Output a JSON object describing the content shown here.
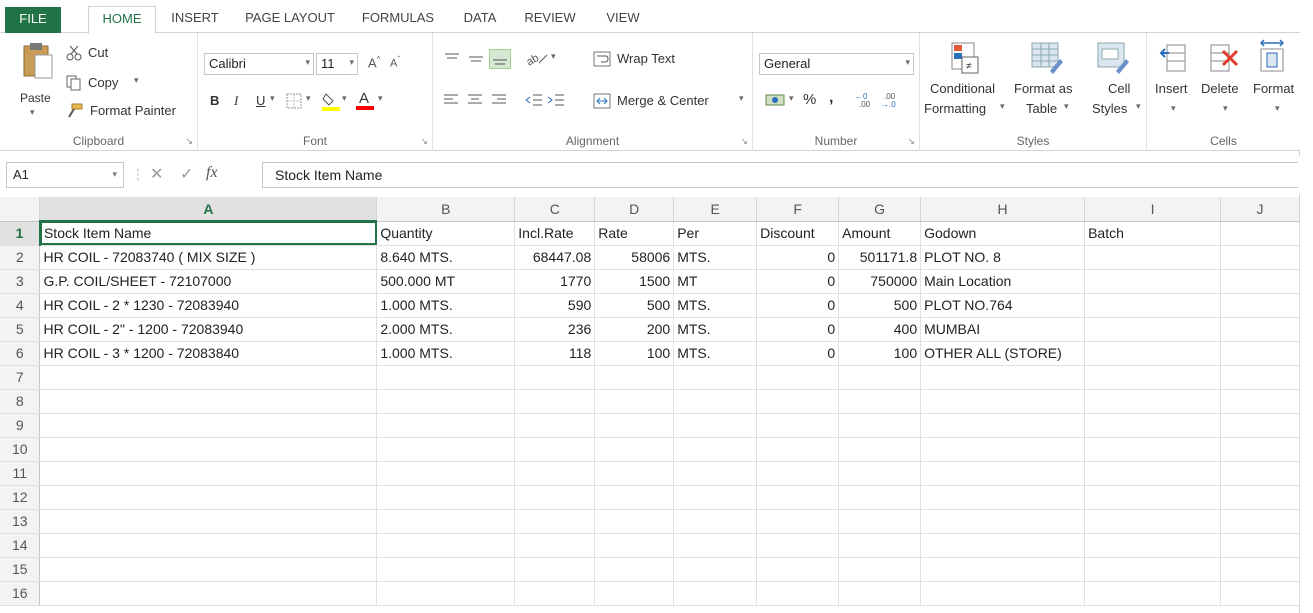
{
  "tabs": [
    "FILE",
    "HOME",
    "INSERT",
    "PAGE LAYOUT",
    "FORMULAS",
    "DATA",
    "REVIEW",
    "VIEW"
  ],
  "clipboard": {
    "paste": "Paste",
    "cut": "Cut",
    "copy": "Copy",
    "format_painter": "Format Painter",
    "label": "Clipboard"
  },
  "font": {
    "name": "Calibri",
    "size": "11",
    "label": "Font",
    "bold": "B",
    "italic": "I",
    "underline": "U"
  },
  "alignment": {
    "wrap_text": "Wrap Text",
    "merge_center": "Merge & Center",
    "label": "Alignment"
  },
  "number": {
    "format": "General",
    "percent": "%",
    "comma": ",",
    "label": "Number"
  },
  "styles": {
    "conditional_1": "Conditional",
    "conditional_2": "Formatting",
    "format_table_1": "Format as",
    "format_table_2": "Table",
    "cell_styles_1": "Cell",
    "cell_styles_2": "Styles",
    "label": "Styles"
  },
  "cells": {
    "insert": "Insert",
    "delete": "Delete",
    "format": "Format",
    "label": "Cells"
  },
  "formula_bar": {
    "name_box": "A1",
    "fx": "fx",
    "content": "Stock Item Name"
  },
  "columns": [
    "A",
    "B",
    "C",
    "D",
    "E",
    "F",
    "G",
    "H",
    "I",
    "J"
  ],
  "rows": [
    [
      "Stock Item Name",
      "Quantity",
      "Incl.Rate",
      "Rate",
      "Per",
      "Discount",
      "Amount",
      "Godown",
      "Batch",
      ""
    ],
    [
      "HR COIL - 72083740  ( MIX SIZE )",
      "8.640 MTS.",
      "68447.08",
      "58006",
      "MTS.",
      "0",
      "501171.8",
      "PLOT NO. 8",
      "",
      ""
    ],
    [
      "G.P. COIL/SHEET - 72107000",
      "500.000 MT",
      "1770",
      "1500",
      "MT",
      "0",
      "750000",
      "Main Location",
      "",
      ""
    ],
    [
      "HR COIL - 2 * 1230 - 72083940",
      "1.000 MTS.",
      "590",
      "500",
      "MTS.",
      "0",
      "500",
      "PLOT NO.764",
      "",
      ""
    ],
    [
      "HR COIL -  2\" - 1200 - 72083940",
      "2.000 MTS.",
      "236",
      "200",
      "MTS.",
      "0",
      "400",
      "MUMBAI",
      "",
      ""
    ],
    [
      "HR COIL - 3 * 1200 - 72083840",
      "1.000 MTS.",
      "118",
      "100",
      "MTS.",
      "0",
      "100",
      "OTHER ALL (STORE)",
      "",
      ""
    ],
    [
      "",
      "",
      "",
      "",
      "",
      "",
      "",
      "",
      "",
      ""
    ],
    [
      "",
      "",
      "",
      "",
      "",
      "",
      "",
      "",
      "",
      ""
    ],
    [
      "",
      "",
      "",
      "",
      "",
      "",
      "",
      "",
      "",
      ""
    ],
    [
      "",
      "",
      "",
      "",
      "",
      "",
      "",
      "",
      "",
      ""
    ],
    [
      "",
      "",
      "",
      "",
      "",
      "",
      "",
      "",
      "",
      ""
    ],
    [
      "",
      "",
      "",
      "",
      "",
      "",
      "",
      "",
      "",
      ""
    ],
    [
      "",
      "",
      "",
      "",
      "",
      "",
      "",
      "",
      "",
      ""
    ],
    [
      "",
      "",
      "",
      "",
      "",
      "",
      "",
      "",
      "",
      ""
    ],
    [
      "",
      "",
      "",
      "",
      "",
      "",
      "",
      "",
      "",
      ""
    ],
    [
      "",
      "",
      "",
      "",
      "",
      "",
      "",
      "",
      "",
      ""
    ]
  ],
  "numeric_columns": [
    2,
    3,
    5,
    6
  ],
  "colors": {
    "accent": "#217346",
    "header_bg": "#f3f3f3"
  }
}
